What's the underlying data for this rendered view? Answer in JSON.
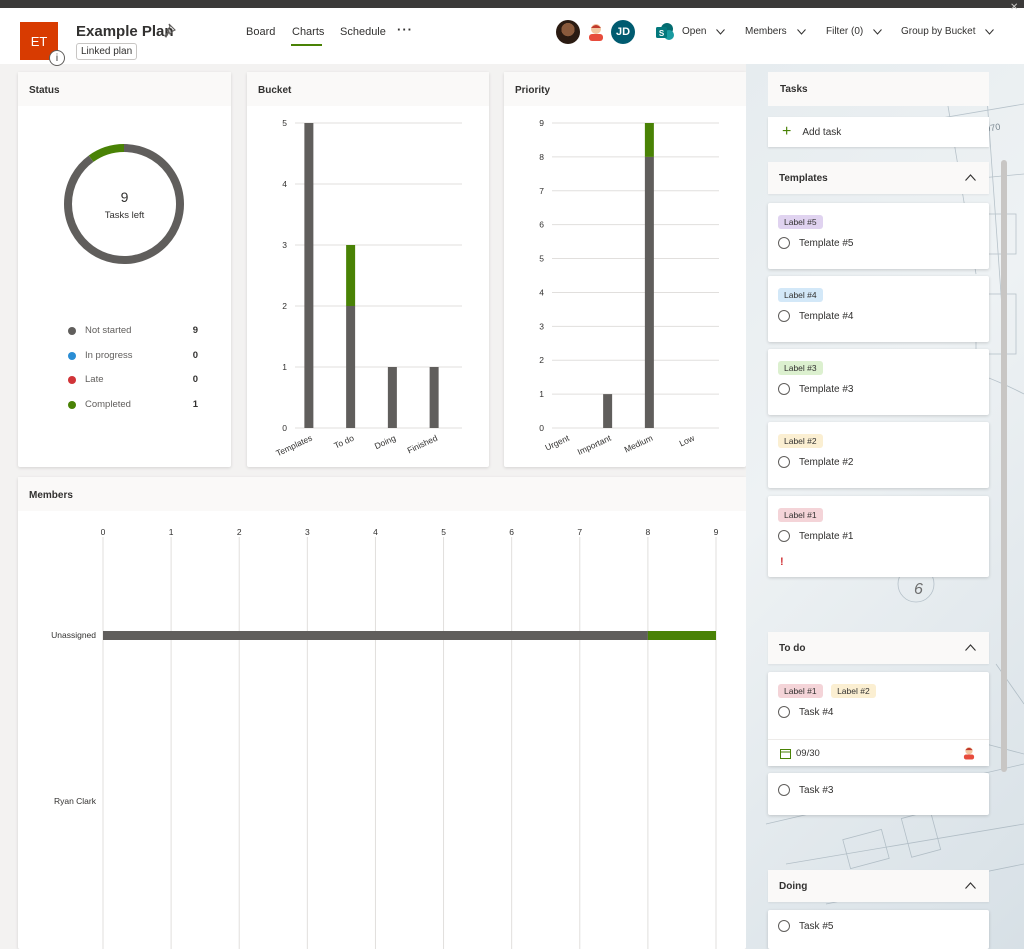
{
  "header": {
    "plan_initials": "ET",
    "plan_name": "Example Plan",
    "linked_label": "Linked plan",
    "info_glyph": "i",
    "tabs": [
      {
        "label": "Board",
        "active": false
      },
      {
        "label": "Charts",
        "active": true
      },
      {
        "label": "Schedule",
        "active": false
      }
    ],
    "more_label": "···",
    "member_initials": "JD",
    "buttons": {
      "open": "Open",
      "members": "Members",
      "filter": "Filter (0)",
      "group_by": "Group by Bucket"
    },
    "accent_color": "#498205",
    "plan_icon_color": "#d83b01"
  },
  "status": {
    "title": "Status",
    "tasks_left": "9",
    "tasks_left_label": "Tasks left",
    "legend": [
      {
        "label": "Not started",
        "count": "9",
        "color": "#605e5c"
      },
      {
        "label": "In progress",
        "count": "0",
        "color": "#2a8dd4"
      },
      {
        "label": "Late",
        "count": "0",
        "color": "#d13438"
      },
      {
        "label": "Completed",
        "count": "1",
        "color": "#498205"
      }
    ]
  },
  "chart_data": [
    {
      "type": "pie",
      "title": "Status",
      "categories": [
        "Not started",
        "In progress",
        "Late",
        "Completed"
      ],
      "values": [
        9,
        0,
        0,
        1
      ],
      "colors": [
        "#605e5c",
        "#2a8dd4",
        "#d13438",
        "#498205"
      ]
    },
    {
      "type": "bar",
      "stacked": true,
      "title": "Bucket",
      "categories": [
        "Templates",
        "To do",
        "Doing",
        "Finished"
      ],
      "series": [
        {
          "values": [
            5,
            2,
            1,
            1
          ],
          "color": "#605e5c"
        },
        {
          "values": [
            0,
            1,
            0,
            0
          ],
          "color": "#498205"
        }
      ],
      "yticks": [
        "0",
        "1",
        "2",
        "3",
        "4",
        "5"
      ],
      "ylim": [
        0,
        5
      ]
    },
    {
      "type": "bar",
      "stacked": true,
      "title": "Priority",
      "categories": [
        "Urgent",
        "Important",
        "Medium",
        "Low"
      ],
      "series": [
        {
          "values": [
            0,
            1,
            8,
            0
          ],
          "color": "#605e5c"
        },
        {
          "values": [
            0,
            0,
            1,
            0
          ],
          "color": "#498205"
        }
      ],
      "yticks": [
        "0",
        "1",
        "2",
        "3",
        "4",
        "5",
        "6",
        "7",
        "8",
        "9"
      ],
      "ylim": [
        0,
        9
      ]
    },
    {
      "type": "bar",
      "orientation": "horizontal",
      "stacked": true,
      "title": "Members",
      "categories": [
        "Unassigned",
        "Ryan Clark"
      ],
      "series": [
        {
          "values": [
            8,
            0
          ],
          "color": "#605e5c"
        },
        {
          "values": [
            1,
            0
          ],
          "color": "#498205"
        }
      ],
      "xticks": [
        "0",
        "1",
        "2",
        "3",
        "4",
        "5",
        "6",
        "7",
        "8",
        "9"
      ],
      "xlim": [
        0,
        9
      ]
    }
  ],
  "tasks_panel": {
    "title": "Tasks",
    "add_task": "Add task",
    "buckets": {
      "templates": "Templates",
      "todo": "To do",
      "doing": "Doing"
    },
    "templates": [
      {
        "label": "Label #5",
        "label_color": "#e0d3f0",
        "name": "Template #5"
      },
      {
        "label": "Label #4",
        "label_color": "#d3e8f8",
        "name": "Template #4"
      },
      {
        "label": "Label #3",
        "label_color": "#dcf0cf",
        "name": "Template #3"
      },
      {
        "label": "Label #2",
        "label_color": "#fbefd2",
        "name": "Template #2"
      },
      {
        "label": "Label #1",
        "label_color": "#f4d4d8",
        "name": "Template #1",
        "priority_mark": "!"
      }
    ],
    "todo": [
      {
        "labels": [
          "Label #1",
          "Label #2"
        ],
        "name": "Task #4",
        "due": "09/30"
      },
      {
        "name": "Task #3"
      }
    ],
    "doing": [
      {
        "name": "Task #5"
      }
    ],
    "label_colors": {
      "label1": "#f4d4d8",
      "label2": "#fbefd2"
    }
  }
}
